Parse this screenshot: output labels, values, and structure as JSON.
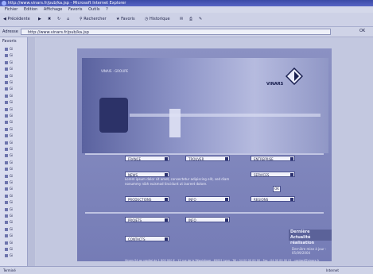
{
  "window": {
    "title": "http://www.vinars.fr/pub/ka.jsp - Microsoft Internet Explorer"
  },
  "menu": [
    "Fichier",
    "Edition",
    "Affichage",
    "Favoris",
    "Outils",
    "?"
  ],
  "toolbar": {
    "back": "Précédente",
    "search": "Rechercher",
    "favorites": "Favoris",
    "history": "Historique"
  },
  "address": {
    "label": "Adresse",
    "value": "http://www.vinars.fr/pub/ka.jsp",
    "go": "OK"
  },
  "leftpane": {
    "title": "Favoris",
    "items": [
      "Gi",
      "Gi",
      "Gi",
      "Gi",
      "Gi",
      "Gi",
      "Gi",
      "Gi",
      "Gi",
      "Gi",
      "Gi",
      "Gi",
      "Gi",
      "Gi",
      "Gi",
      "Gi",
      "Gi",
      "Gi",
      "Gi",
      "Gi",
      "Gi",
      "Gi",
      "Gi",
      "Gi",
      "Gi",
      "Gi",
      "Gi",
      "Gi",
      "Gi",
      "Gi",
      "Gi",
      "Gi"
    ]
  },
  "page": {
    "nav_label": "VINAIS · GROUPE",
    "logo": "VINARS",
    "selects_row1": [
      "FRANCE",
      "TROUVER",
      "ENTREPRISE"
    ],
    "selects_row2_left": "NEWS",
    "selects_row2_right": "SERVICES",
    "news_text": "Lorem ipsum dolor sit amet, consectetur adipiscing elit, sed diam nonummy nibh euismod tincidunt ut laoreet dolore.",
    "news_btn": "OK",
    "selects_row3": [
      "PRODUCTIONS",
      "INFO",
      "REGIONS"
    ],
    "selects_row4": [
      "PROJETS",
      "INFO"
    ],
    "selects_row5": "CONTACTS",
    "banner": [
      "Dernière",
      "Actualité réalisation"
    ],
    "update": "Dernière mise à jour : 05/09/2004",
    "footer": "Vinars SA au capital de 1 800 000 € - 12 rue de la République - 69001 Lyon - Tél : 04 00 00 00 00 - Fax : 04 00 00 00 01 - contact@vinars.fr"
  },
  "status": {
    "left": "Terminé",
    "right": "Internet"
  }
}
